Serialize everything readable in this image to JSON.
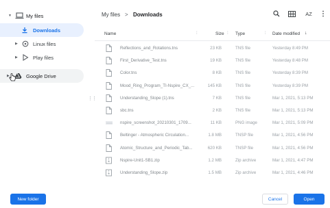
{
  "sidebar": {
    "items": [
      {
        "label": "My files",
        "expanded": true,
        "icon": "laptop-icon"
      },
      {
        "label": "Downloads",
        "selected": true,
        "icon": "download-icon"
      },
      {
        "label": "Linux files",
        "icon": "linux-icon"
      },
      {
        "label": "Play files",
        "icon": "play-store-icon"
      },
      {
        "label": "Google Drive",
        "icon": "drive-icon"
      }
    ]
  },
  "breadcrumb": {
    "root": "My files",
    "separator": ">",
    "current": "Downloads"
  },
  "toolbar": {
    "search_icon": "search-icon",
    "view_icon": "grid-view-icon",
    "sort_label": "AZ",
    "more_icon": "more-vert-icon"
  },
  "table": {
    "headers": {
      "name": "Name",
      "size": "Size",
      "type": "Type",
      "date": "Date modified",
      "sort_arrow": "↓"
    },
    "rows": [
      {
        "name": "Reflections_and_Rotations.tns",
        "size": "23 KB",
        "type": "TNS file",
        "date": "Yesterday 8:49 PM",
        "icon": "file-icon"
      },
      {
        "name": "First_Derivative_Test.tns",
        "size": "19 KB",
        "type": "TNS file",
        "date": "Yesterday 8:48 PM",
        "icon": "file-icon"
      },
      {
        "name": "Color.tns",
        "size": "8 KB",
        "type": "TNS file",
        "date": "Yesterday 8:39 PM",
        "icon": "file-icon"
      },
      {
        "name": "Mood_Ring_Program_TI-Nspire_CX_...",
        "size": "145 KB",
        "type": "TNS file",
        "date": "Yesterday 8:39 PM",
        "icon": "file-icon"
      },
      {
        "name": "Understanding_Slope (1).tns",
        "size": "7 KB",
        "type": "TNS file",
        "date": "Mar 1, 2021, 5:13 PM",
        "icon": "file-icon"
      },
      {
        "name": "sbc.tns",
        "size": "2 KB",
        "type": "TNS file",
        "date": "Mar 1, 2021, 5:13 PM",
        "icon": "file-icon"
      },
      {
        "name": "nspire_screenshot_20210301_1709...",
        "size": "11 KB",
        "type": "PNG image",
        "date": "Mar 1, 2021, 5:09 PM",
        "icon": "image-thumb-icon"
      },
      {
        "name": "Beltinger - Atmospheric Circulation...",
        "size": "1.8 MB",
        "type": "TNSP file",
        "date": "Mar 1, 2021, 4:56 PM",
        "icon": "file-icon"
      },
      {
        "name": "Atomic_Structure_and_Periodic_Tab...",
        "size": "620 KB",
        "type": "TNSP file",
        "date": "Mar 1, 2021, 4:56 PM",
        "icon": "file-icon"
      },
      {
        "name": "Nspire-Unit1-SB1.zip",
        "size": "1.2 MB",
        "type": "Zip archive",
        "date": "Mar 1, 2021, 4:47 PM",
        "icon": "archive-icon"
      },
      {
        "name": "Understanding_Slope.zip",
        "size": "1.5 MB",
        "type": "Zip archive",
        "date": "Mar 1, 2021, 4:46 PM",
        "icon": "archive-icon"
      }
    ]
  },
  "footer": {
    "new_folder": "New folder",
    "cancel": "Cancel",
    "open": "Open"
  },
  "colors": {
    "accent": "#1a73e8",
    "selected_bg": "#e8f0fe"
  }
}
